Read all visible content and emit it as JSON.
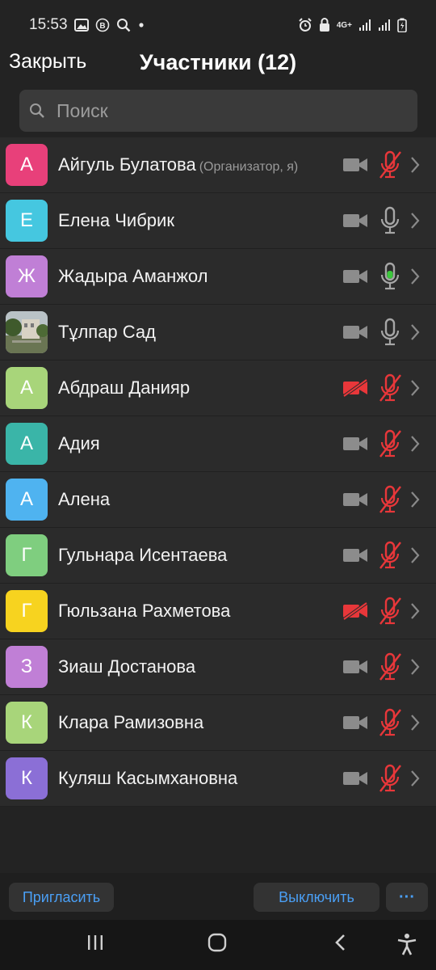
{
  "status_bar": {
    "time": "15:53",
    "network": "4G+"
  },
  "header": {
    "close_label": "Закрыть",
    "title": "Участники (12)"
  },
  "search": {
    "placeholder": "Поиск"
  },
  "participants": [
    {
      "initial": "А",
      "name": "Айгуль Булатова",
      "role": "(Организатор, я)",
      "avatar_color": "#e8407a",
      "camera": "off",
      "mic": "muted"
    },
    {
      "initial": "Е",
      "name": "Елена Чибрик",
      "role": "",
      "avatar_color": "#45c7e0",
      "camera": "off",
      "mic": "on"
    },
    {
      "initial": "Ж",
      "name": "Жадыра Аманжол",
      "role": "",
      "avatar_color": "#c07fd6",
      "camera": "off",
      "mic": "speaking"
    },
    {
      "initial": "",
      "name": "Тұлпар Сад",
      "role": "",
      "avatar_color": "#6b7a5a",
      "camera": "off",
      "mic": "on",
      "photo": true
    },
    {
      "initial": "А",
      "name": "Абдраш Данияр",
      "role": "",
      "avatar_color": "#a8d57a",
      "camera": "blocked",
      "mic": "muted"
    },
    {
      "initial": "А",
      "name": "Адия",
      "role": "",
      "avatar_color": "#3ab5a8",
      "camera": "off",
      "mic": "muted"
    },
    {
      "initial": "А",
      "name": "Алена",
      "role": "",
      "avatar_color": "#4fb3f0",
      "camera": "off",
      "mic": "muted"
    },
    {
      "initial": "Г",
      "name": "Гульнара Исентаева",
      "role": "",
      "avatar_color": "#7fce7f",
      "camera": "off",
      "mic": "muted"
    },
    {
      "initial": "Г",
      "name": "Гюльзана Рахметова",
      "role": "",
      "avatar_color": "#f7d31f",
      "camera": "blocked",
      "mic": "muted"
    },
    {
      "initial": "З",
      "name": "Зиаш Достанова",
      "role": "",
      "avatar_color": "#c07fd6",
      "camera": "off",
      "mic": "muted"
    },
    {
      "initial": "К",
      "name": "Клара Рамизовна",
      "role": "",
      "avatar_color": "#a8d57a",
      "camera": "off",
      "mic": "muted"
    },
    {
      "initial": "К",
      "name": "Куляш Касымхановна",
      "role": "",
      "avatar_color": "#8b6fd6",
      "camera": "off",
      "mic": "muted"
    }
  ],
  "footer": {
    "invite_label": "Пригласить",
    "mute_label": "Выключить",
    "more_label": "···"
  },
  "colors": {
    "accent": "#4a9ff5",
    "muted_red": "#e8373a",
    "speaking_green": "#3cc83c"
  }
}
